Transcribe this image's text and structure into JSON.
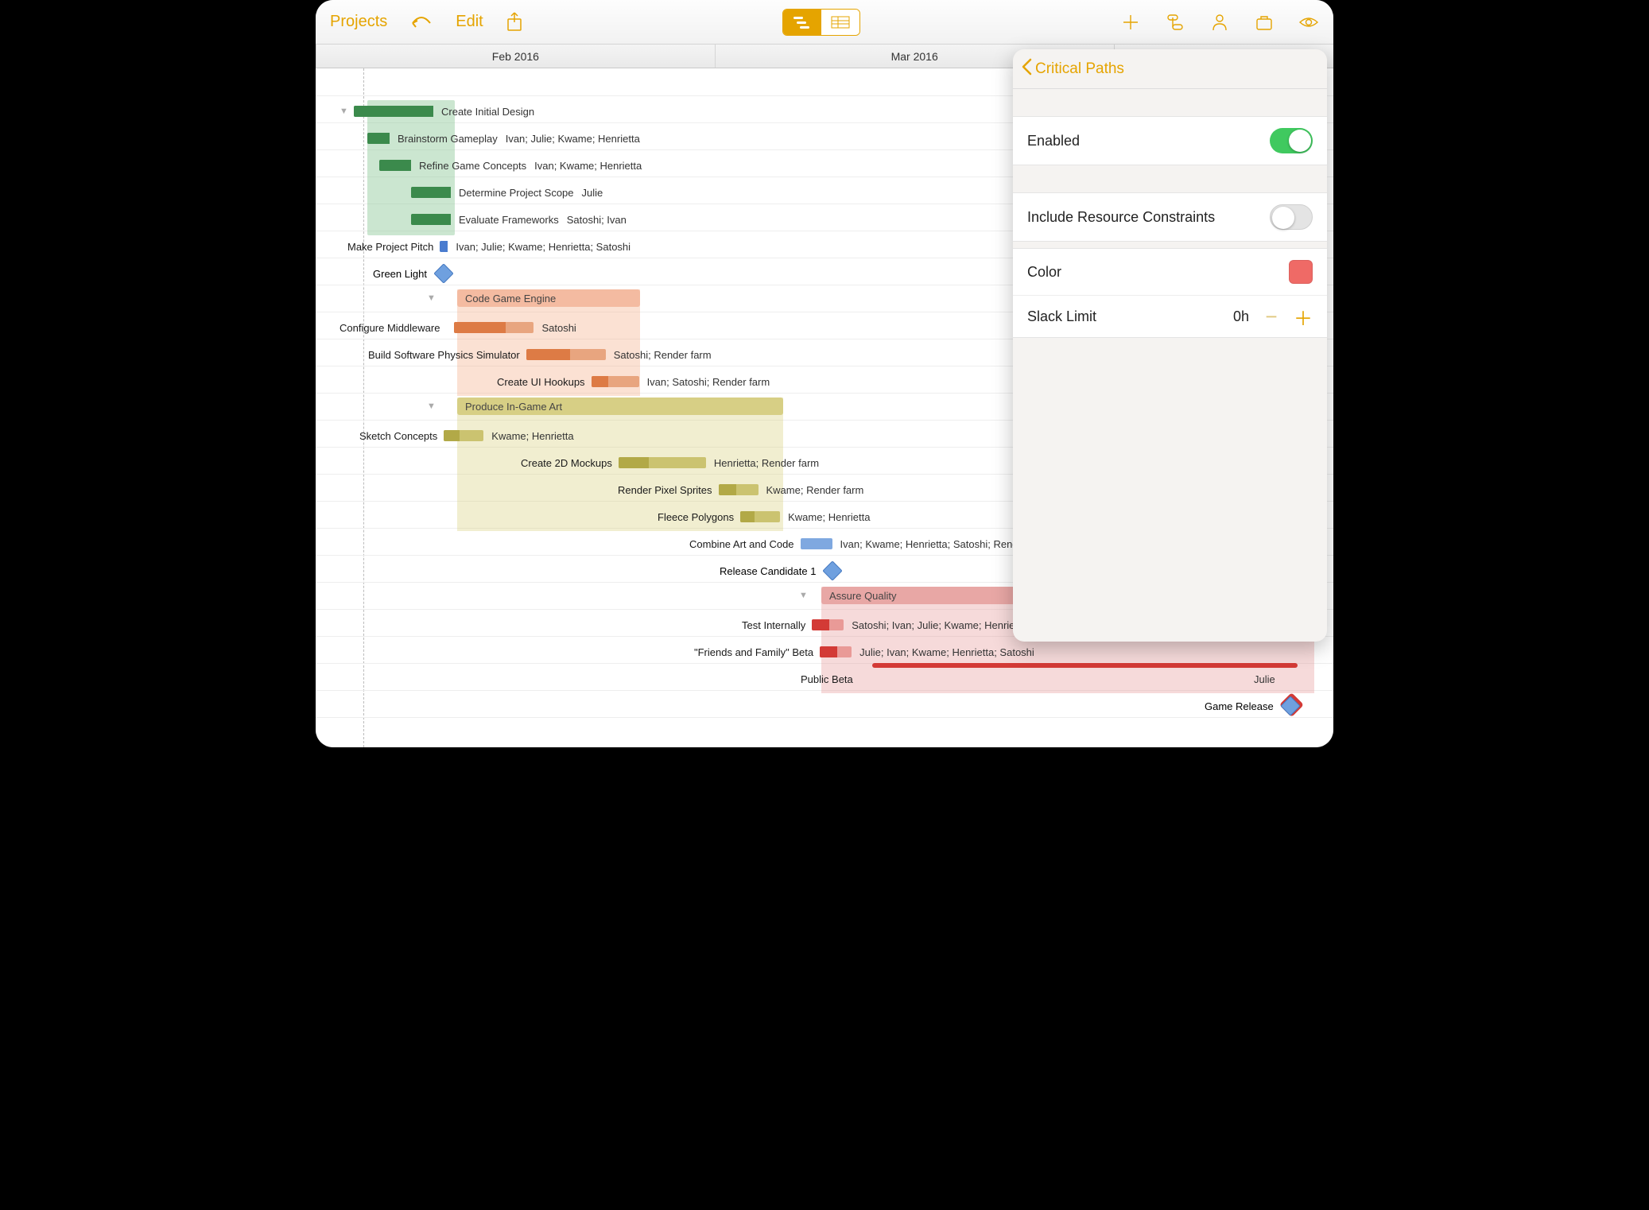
{
  "toolbar": {
    "projects": "Projects",
    "edit": "Edit"
  },
  "timeline": [
    "Feb 2016",
    "Mar 2016"
  ],
  "tasks": {
    "g1": "Create Initial Design",
    "t1": "Brainstorm Gameplay",
    "r1": "Ivan; Julie; Kwame; Henrietta",
    "t2": "Refine Game Concepts",
    "r2": "Ivan; Kwame; Henrietta",
    "t3": "Determine Project Scope",
    "r3": "Julie",
    "t4": "Evaluate Frameworks",
    "r4": "Satoshi; Ivan",
    "t5": "Make Project Pitch",
    "r5": "Ivan; Julie; Kwame; Henrietta; Satoshi",
    "m1": "Green Light",
    "g2": "Code Game Engine",
    "t6": "Configure Middleware",
    "r6": "Satoshi",
    "t7": "Build Software Physics Simulator",
    "r7": "Satoshi; Render farm",
    "t8": "Create UI Hookups",
    "r8": "Ivan; Satoshi; Render farm",
    "g3": "Produce In-Game Art",
    "t9": "Sketch Concepts",
    "r9": "Kwame; Henrietta",
    "t10": "Create 2D Mockups",
    "r10": "Henrietta; Render farm",
    "t11": "Render Pixel Sprites",
    "r11": "Kwame; Render farm",
    "t12": "Fleece Polygons",
    "r12": "Kwame; Henrietta",
    "t13": "Combine Art and Code",
    "r13": "Ivan; Kwame; Henrietta; Satoshi; Render farm",
    "m2": "Release Candidate 1",
    "g4": "Assure Quality",
    "t14": "Test Internally",
    "r14": "Satoshi; Ivan; Julie; Kwame; Henrietta",
    "t15": "\"Friends and Family\" Beta",
    "r15": "Julie; Ivan; Kwame; Henrietta; Satoshi",
    "t16": "Public Beta",
    "r16": "Julie",
    "m3": "Game Release"
  },
  "popover": {
    "title": "Critical Paths",
    "enabled_label": "Enabled",
    "include_label": "Include Resource Constraints",
    "color_label": "Color",
    "slack_label": "Slack Limit",
    "slack_value": "0h",
    "color_hex": "#ef6a66"
  }
}
